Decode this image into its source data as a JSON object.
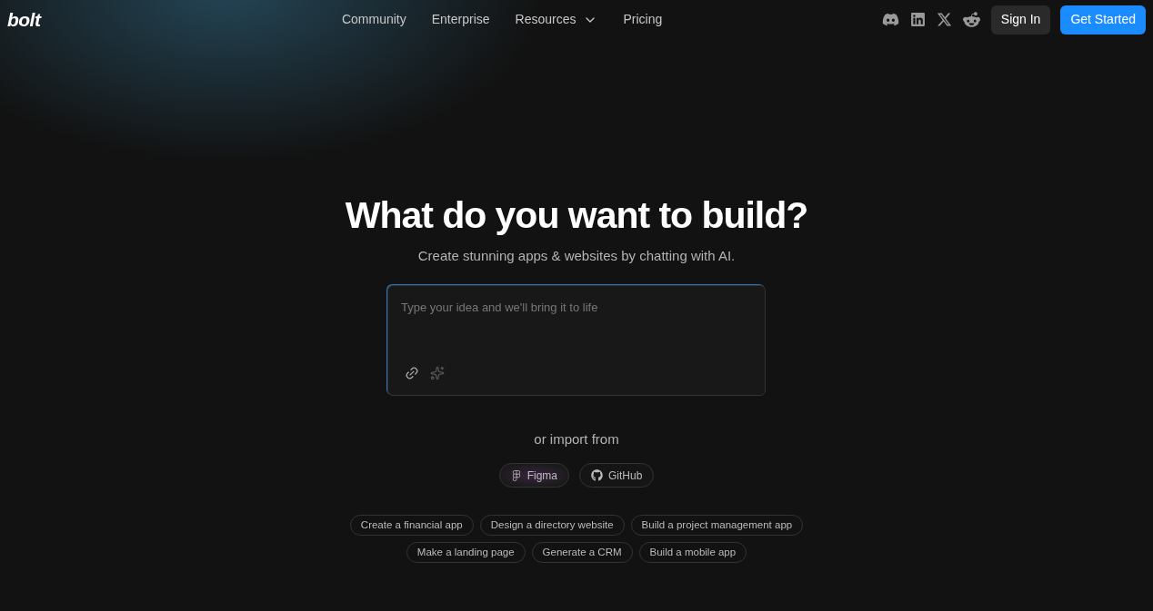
{
  "logo": "bolt",
  "nav": [
    {
      "label": "Community",
      "has_menu": false
    },
    {
      "label": "Enterprise",
      "has_menu": false
    },
    {
      "label": "Resources",
      "has_menu": true
    },
    {
      "label": "Pricing",
      "has_menu": false
    }
  ],
  "social": [
    {
      "kind": "discord"
    },
    {
      "kind": "linkedin"
    },
    {
      "kind": "x"
    },
    {
      "kind": "reddit"
    }
  ],
  "sign_in": "Sign In",
  "get_started": "Get Started",
  "heading": "What do you want to build?",
  "subheading": "Create stunning apps & websites by chatting with AI.",
  "prompt": {
    "placeholder": "Type your idea and we'll bring it to life"
  },
  "import_label": "or import from",
  "imports": [
    {
      "kind": "figma",
      "label": "Figma"
    },
    {
      "kind": "github",
      "label": "GitHub"
    }
  ],
  "suggestion_rows": [
    [
      "Create a financial app",
      "Design a directory website",
      "Build a project management app"
    ],
    [
      "Make a landing page",
      "Generate a CRM",
      "Build a mobile app"
    ]
  ]
}
